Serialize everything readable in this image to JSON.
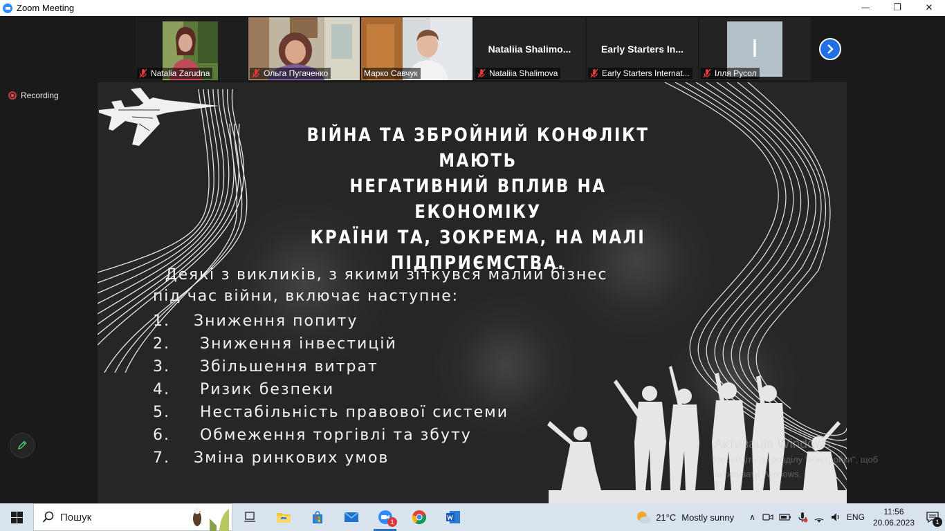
{
  "window": {
    "title": "Zoom Meeting",
    "min": "—",
    "max": "❐",
    "close": "✕"
  },
  "participants": [
    {
      "name": "Natalia Zarudna",
      "big_name": "",
      "has_video": true,
      "muted": true
    },
    {
      "name": "Ольга Пугаченко",
      "big_name": "",
      "has_video": true,
      "muted": true
    },
    {
      "name": "Марко Савчук",
      "big_name": "",
      "has_video": true,
      "muted": false,
      "active_speaker": true
    },
    {
      "name": "Nataliia Shalimova",
      "big_name": "Nataliia  Shalimo...",
      "has_video": false,
      "muted": true
    },
    {
      "name": "Early Starters Internat...",
      "big_name": "Early Starters  In...",
      "has_video": false,
      "muted": true
    },
    {
      "name": "Ілля Русол",
      "big_name": "І",
      "has_video": false,
      "muted": true
    }
  ],
  "recording_label": "Recording",
  "slide": {
    "title_lines": [
      "ВІЙНА ТА ЗБРОЙНИЙ КОНФЛІКТ МАЮТЬ",
      "НЕГАТИВНИЙ ВПЛИВ НА ЕКОНОМІКУ",
      "КРАЇНИ ТА, ЗОКРЕМА, НА МАЛІ",
      "ПІДПРИЄМСТВА."
    ],
    "intro_lines": [
      "  Деякі з викликів, з якими зіткувся малий бізнес",
      "під час війни, включає наступне:"
    ],
    "items": [
      {
        "num": "1.",
        "text": " Зниження попиту"
      },
      {
        "num": "2.",
        "text": "  Зниження інвестицій"
      },
      {
        "num": "3.",
        "text": "  Збільшення витрат"
      },
      {
        "num": "4.",
        "text": "  Ризик безпеки"
      },
      {
        "num": "5.",
        "text": "  Нестабільність правової системи"
      },
      {
        "num": "6.",
        "text": "  Обмеження торгівлі та збуту"
      },
      {
        "num": "7.",
        "text": " Зміна ринкових умов"
      }
    ]
  },
  "watermark": {
    "title": "Активація Windows",
    "line1": "Перейдіть до розділу \"Настройки\", щоб",
    "line2": "активувати Windows."
  },
  "taskbar": {
    "search_placeholder": "Пошук",
    "weather_temp": "21°C",
    "weather_text": "Mostly sunny",
    "language": "ENG",
    "time": "11:56",
    "date": "20.06.2023",
    "zoom_badge": "1",
    "notification_count": "1",
    "icons": [
      "start-icon",
      "task-view-icon",
      "file-explorer-icon",
      "microsoft-store-icon",
      "mail-icon",
      "zoom-icon",
      "chrome-icon",
      "word-icon"
    ]
  }
}
